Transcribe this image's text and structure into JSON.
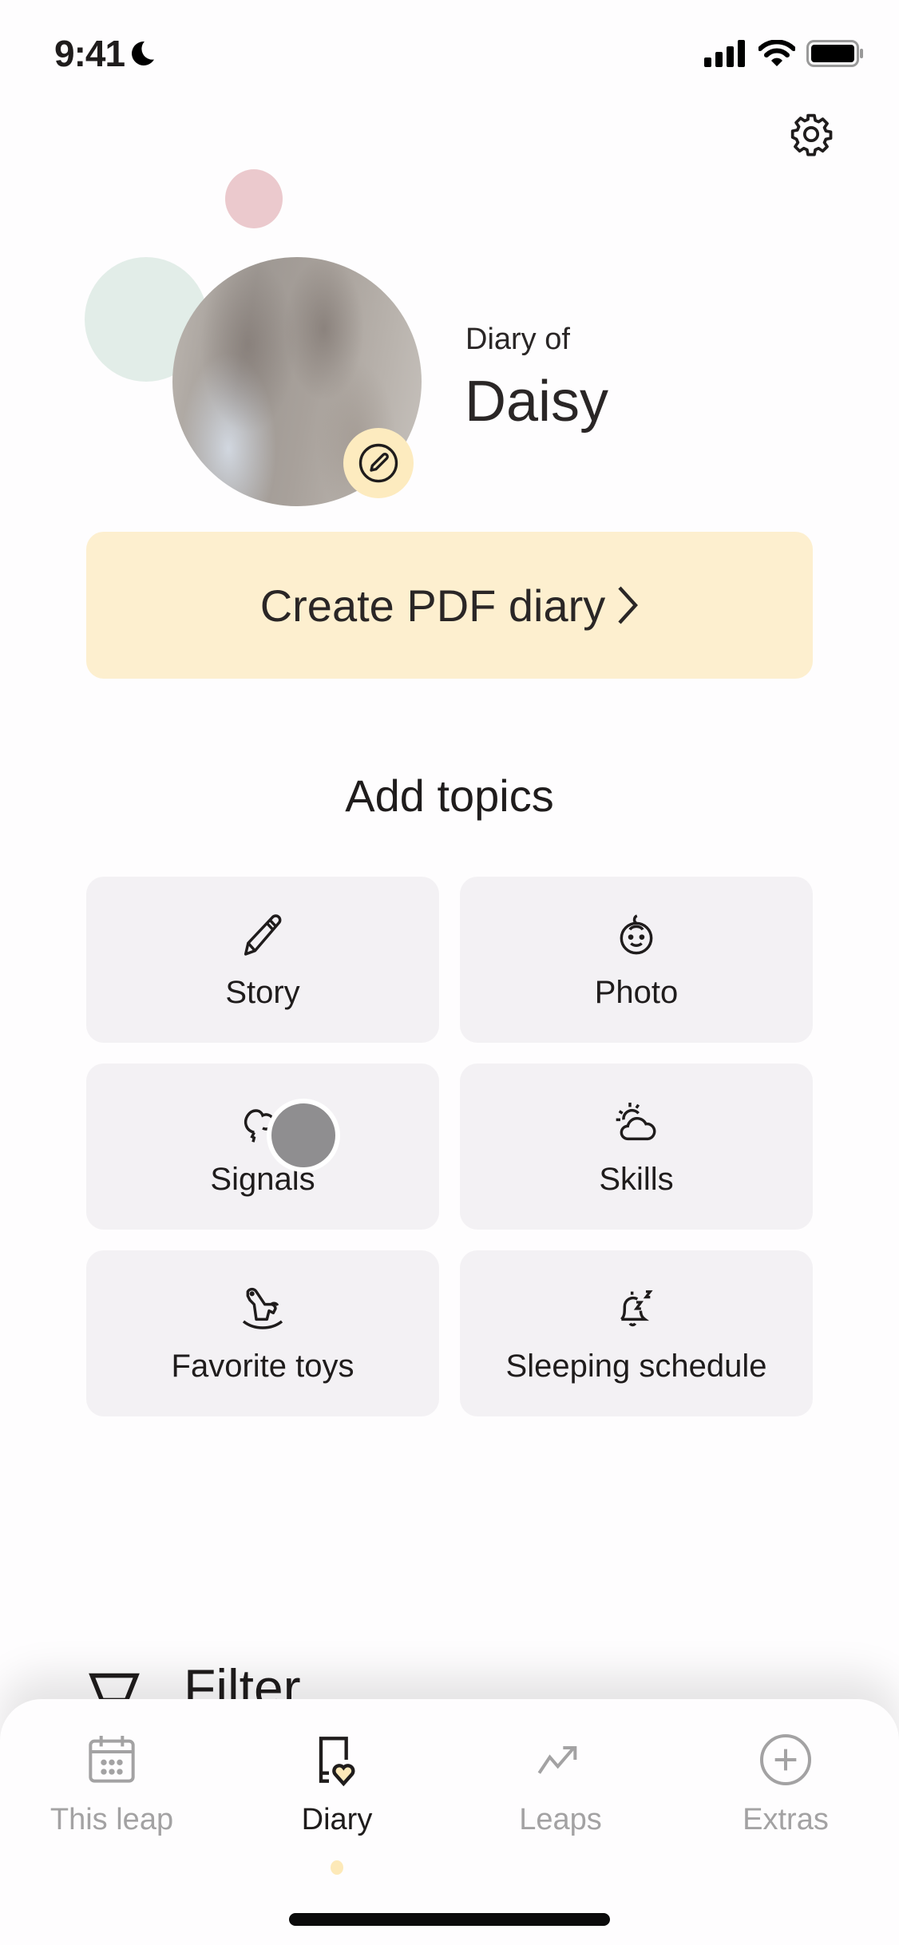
{
  "status_bar": {
    "time": "9:41",
    "focus_icon": "moon-icon",
    "signal_icon": "cellular-signal-icon",
    "wifi_icon": "wifi-icon",
    "battery_icon": "battery-icon"
  },
  "header": {
    "settings_icon": "gear-icon"
  },
  "profile": {
    "subtitle": "Diary of",
    "name": "Daisy",
    "edit_icon": "pencil-circle-icon"
  },
  "pdf_button": {
    "label": "Create PDF diary",
    "chevron": "›"
  },
  "topics": {
    "title": "Add topics",
    "items": [
      {
        "label": "Story",
        "icon": "pencil-icon"
      },
      {
        "label": "Photo",
        "icon": "baby-face-icon"
      },
      {
        "label": "Signals",
        "icon": "thought-bubble-icon"
      },
      {
        "label": "Skills",
        "icon": "sun-cloud-icon"
      },
      {
        "label": "Favorite toys",
        "icon": "rocking-horse-icon"
      },
      {
        "label": "Sleeping schedule",
        "icon": "bell-sleep-icon"
      }
    ]
  },
  "filter": {
    "label": "Filter",
    "icon": "filter-icon"
  },
  "tab_bar": {
    "active": "Diary",
    "colors": {
      "active": "#1f1c1c",
      "inactive": "#a3a2a3",
      "accent": "#fde9b8"
    },
    "tabs": [
      {
        "label": "This leap",
        "icon": "calendar-icon"
      },
      {
        "label": "Diary",
        "icon": "diary-heart-icon"
      },
      {
        "label": "Leaps",
        "icon": "trend-up-icon"
      },
      {
        "label": "Extras",
        "icon": "plus-circle-icon"
      }
    ]
  },
  "colors": {
    "pdf_button_bg": "#fdefcf",
    "tile_bg": "#f3f1f4",
    "edit_badge_bg": "#fdebbf",
    "bubble_pink": "#ebc9cd",
    "bubble_green": "#e2ede8"
  }
}
